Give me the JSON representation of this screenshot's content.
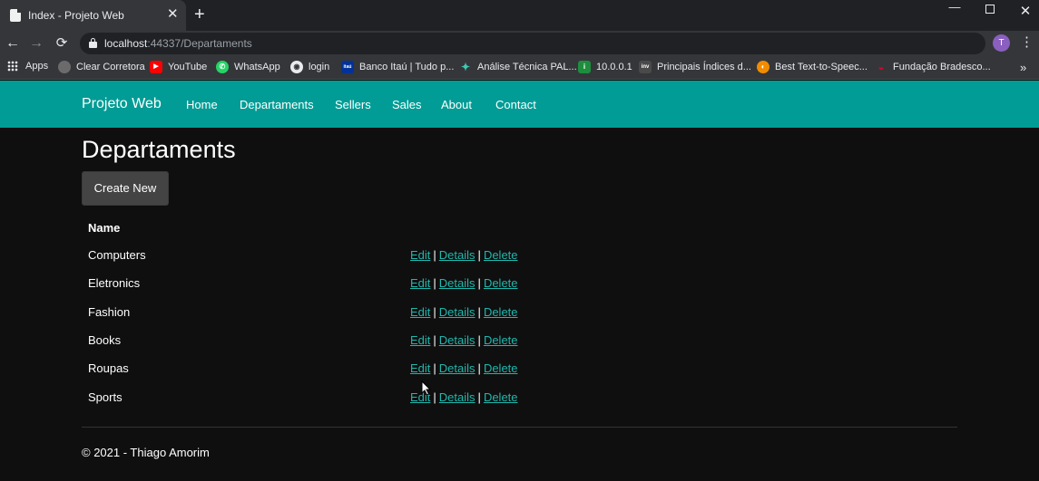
{
  "browser": {
    "tab_title": "Index - Projeto Web",
    "tab_close": "✕",
    "new_tab": "+",
    "window_controls": {
      "minimize": "—",
      "close": "✕"
    },
    "nav": {
      "back": "←",
      "forward": "→",
      "reload": "⟳"
    },
    "url_host": "localhost",
    "url_rest": ":44337/Departaments",
    "star": "☆",
    "profile_initial": "T",
    "menu": "⋮",
    "bookmarks": [
      {
        "label": "Apps",
        "icon": "apps-grid-icon"
      },
      {
        "label": "Clear Corretora",
        "icon": "clear-icon",
        "color": "#6b6b6b",
        "glyph": ""
      },
      {
        "label": "YouTube",
        "icon": "youtube-icon",
        "color": "#ff0000",
        "glyph": "▶"
      },
      {
        "label": "WhatsApp",
        "icon": "whatsapp-icon",
        "color": "#25d366",
        "glyph": "✆"
      },
      {
        "label": "login",
        "icon": "globe-icon",
        "color": "#5f6368",
        "glyph": "◉"
      },
      {
        "label": "Banco Itaú | Tudo p...",
        "icon": "itau-icon",
        "color": "#003399",
        "glyph": "itaú"
      },
      {
        "label": "Análise Técnica PAL...",
        "icon": "analysis-icon",
        "color": "#1a9c8c",
        "glyph": "✦"
      },
      {
        "label": "10.0.0.1",
        "icon": "info-icon",
        "color": "#1e8e3e",
        "glyph": "i"
      },
      {
        "label": "Principais Índices d...",
        "icon": "inv-icon",
        "color": "#4a4a4a",
        "glyph": "inv"
      },
      {
        "label": "Best Text-to-Speec...",
        "icon": "speech-icon",
        "color": "#f08c00",
        "glyph": "◐"
      },
      {
        "label": "Fundação Bradesco...",
        "icon": "bradesco-icon",
        "color": "#cc092f",
        "glyph": "◒"
      }
    ],
    "bookmarks_more": "»"
  },
  "navbar": {
    "brand": "Projeto Web",
    "links": [
      "Home",
      "Departaments",
      "Sellers",
      "Sales",
      "About",
      "Contact"
    ]
  },
  "main": {
    "title": "Departaments",
    "create_label": "Create New",
    "column_header": "Name",
    "actions": {
      "edit": "Edit",
      "details": "Details",
      "delete": "Delete",
      "separator": "|"
    },
    "rows": [
      "Computers",
      "Eletronics",
      "Fashion",
      "Books",
      "Roupas",
      "Sports"
    ]
  },
  "footer": {
    "text": "© 2021 - Thiago Amorim"
  },
  "colors": {
    "navbar": "#009c95",
    "link": "#20b7ad",
    "background": "#0f0f0f",
    "button": "#444444"
  }
}
